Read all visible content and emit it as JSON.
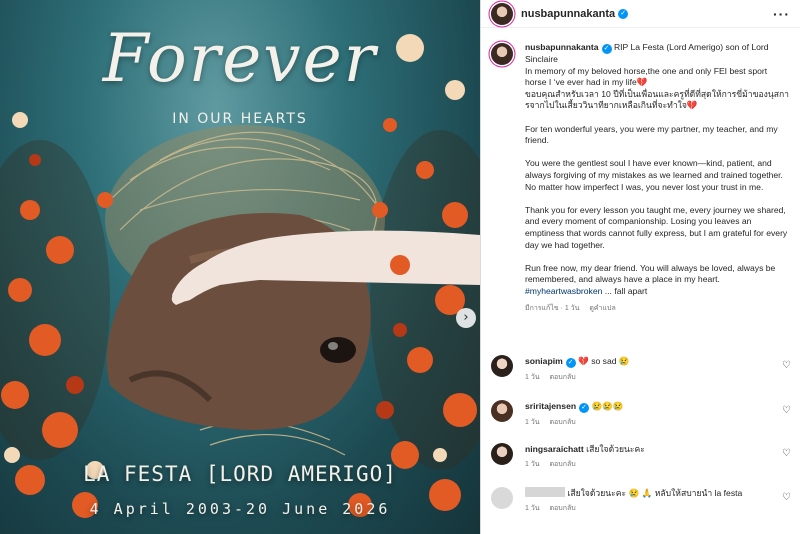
{
  "post": {
    "image": {
      "title": "Forever",
      "subtitle": "IN OUR HEARTS",
      "horse_name": "LA FESTA [LORD AMERIGO]",
      "dates": "4 April 2003-20 June 2026",
      "next_icon": "chevron-right-icon"
    },
    "header": {
      "username": "nusbapunnakanta",
      "more_icon": "more-horizontal-icon"
    },
    "caption": {
      "username": "nusbapunnakanta",
      "line1": "RIP La Festa (Lord Amerigo) son of Lord Sinclaire",
      "line2": "In memory of my beloved horse,the one and only FEI best sport horse I ‘ve ever had in my life💔",
      "thai": "ขอบคุณสำหรับเวลา 10 ปีที่เป็นเพื่อนและครูที่ดีที่สุดให้การขี่ม้าของนุสการจากไปในเสี้ยววินาทียากเหลือเกินที่จะทำใจ💔",
      "p2": "For ten wonderful years, you were my partner, my teacher, and my friend.",
      "p3": "You were the gentlest soul I have ever known—kind, patient, and always forgiving of my mistakes as we learned and trained together. No matter how imperfect I was, you never lost your trust in me.",
      "p4": "Thank you for every lesson you taught me, every journey we shared, and every moment of companionship. Losing you leaves an emptiness that words cannot fully express, but I am grateful for every day we had together.",
      "p5": "Run free now, my dear friend. You will always be loved, always be remembered, and always have a place in my heart.",
      "hashtag": "#myheartwasbroken",
      "tail": "... fall apart",
      "edited": "มีการแก้ไข · 1 วัน",
      "translate": "ดูคำแปล"
    },
    "comments": [
      {
        "username": "soniapim",
        "text": "💔 so sad 😢",
        "time": "1 วัน",
        "reply": "ตอบกลับ"
      },
      {
        "username": "sriritajensen",
        "text": "😢😢😢",
        "time": "1 วัน",
        "reply": "ตอบกลับ"
      },
      {
        "username": "ningsaraichatt",
        "text": "เสียใจด้วยนะคะ",
        "time": "1 วัน",
        "reply": "ตอบกลับ"
      },
      {
        "username": "",
        "text": "เสียใจด้วยนะคะ 😢 🙏 หลับให้สบายนำ la festa",
        "time": "1 วัน",
        "reply": "ตอบกลับ"
      }
    ],
    "colors": {
      "verified": "#0095f6",
      "link": "#00376b",
      "story_ring": "#d6249f"
    }
  }
}
